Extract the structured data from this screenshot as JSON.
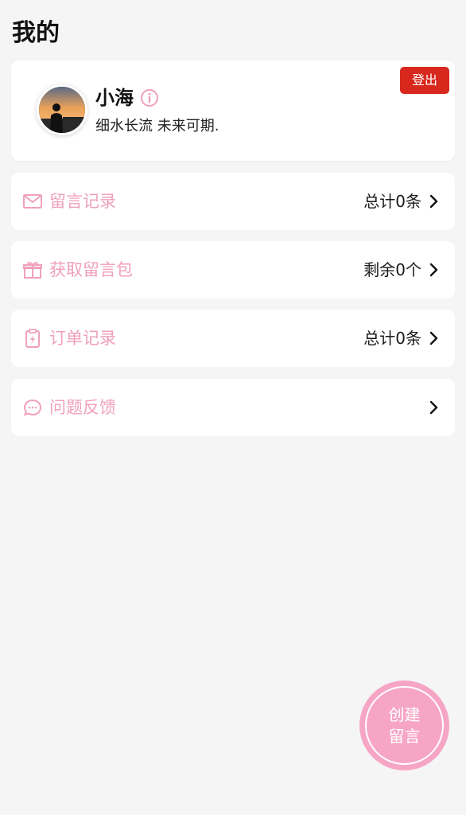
{
  "header": {
    "title": "我的"
  },
  "profile": {
    "avatar_icon": "sunset-silhouette-avatar",
    "name": "小海",
    "info_icon": "info-icon",
    "bio": "细水长流 未来可期.",
    "logout_label": "登出"
  },
  "menu": {
    "items": [
      {
        "icon": "envelope-icon",
        "label": "留言记录",
        "value": "总计0条"
      },
      {
        "icon": "gift-icon",
        "label": "获取留言包",
        "value": "剩余0个"
      },
      {
        "icon": "clipboard-icon",
        "label": "订单记录",
        "value": "总计0条"
      },
      {
        "icon": "feedback-icon",
        "label": "问题反馈",
        "value": ""
      }
    ]
  },
  "fab": {
    "line1": "创建",
    "line2": "留言"
  },
  "colors": {
    "background": "#f5f5f5",
    "accent_pink": "#f0a0bc",
    "fab_pink": "#f6a6c4",
    "logout_red": "#d8281e"
  }
}
